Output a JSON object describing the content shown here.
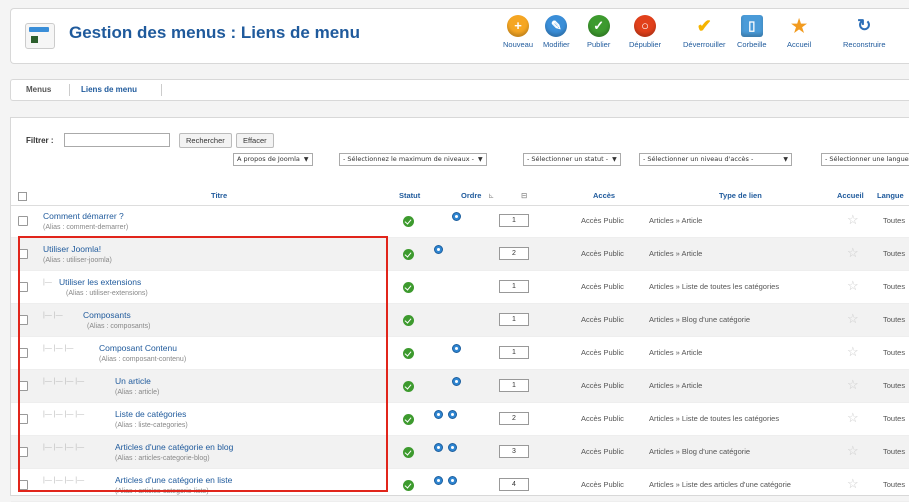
{
  "header": {
    "title": "Gestion des menus : Liens de menu"
  },
  "toolbar": [
    {
      "label": "Nouveau",
      "icon": "plus-icon",
      "color": "#f5a623"
    },
    {
      "label": "Modifier",
      "icon": "pencil-icon",
      "color": "#3a8ed8"
    },
    {
      "label": "Publier",
      "icon": "check-icon",
      "color": "#3d9a2e"
    },
    {
      "label": "Dépublier",
      "icon": "unpublish-icon",
      "color": "#e1401b"
    },
    {
      "label": "Déverrouiller",
      "icon": "checkmark-icon",
      "color": "#f5b400"
    },
    {
      "label": "Corbeille",
      "icon": "trash-icon",
      "color": "#4a9bd8"
    },
    {
      "label": "Accueil",
      "icon": "star-icon",
      "color": "#f29b1f"
    },
    {
      "label": "Reconstruire",
      "icon": "refresh-icon",
      "color": "#2d6fb8"
    }
  ],
  "tabs": [
    "Menus",
    "Liens de menu"
  ],
  "filter": {
    "label": "Filtrer :",
    "search_button": "Rechercher",
    "clear_button": "Effacer",
    "selects": [
      "A propos de Joomla",
      "- Sélectionnez le maximum de niveaux -",
      "- Sélectionner un statut -",
      "- Sélectionner un niveau d'accès -",
      "- Sélectionner une langue"
    ]
  },
  "columns": {
    "title": "Titre",
    "status": "Statut",
    "order": "Ordre",
    "access": "Accès",
    "type": "Type de lien",
    "home": "Accueil",
    "language": "Langue"
  },
  "rows": [
    {
      "title": "Comment démarrer ?",
      "alias": "(Alias : comment-demarrer)",
      "tree": "",
      "order": "1",
      "access": "Accès Public",
      "type": "Articles » Article",
      "language": "Toutes"
    },
    {
      "title": "Utiliser Joomla!",
      "alias": "(Alias : utiliser-joomla)",
      "tree": "",
      "order": "2",
      "access": "Accès Public",
      "type": "Articles » Article",
      "language": "Toutes"
    },
    {
      "title": "Utiliser les extensions",
      "alias": "(Alias : utiliser-extensions)",
      "tree": "|—",
      "order": "1",
      "access": "Accès Public",
      "type": "Articles » Liste de toutes les catégories",
      "language": "Toutes"
    },
    {
      "title": "Composants",
      "alias": "(Alias : composants)",
      "tree": "|— |—",
      "order": "1",
      "access": "Accès Public",
      "type": "Articles » Blog d'une catégorie",
      "language": "Toutes"
    },
    {
      "title": "Composant Contenu",
      "alias": "(Alias : composant-contenu)",
      "tree": "|— |— |—",
      "order": "1",
      "access": "Accès Public",
      "type": "Articles » Article",
      "language": "Toutes"
    },
    {
      "title": "Un article",
      "alias": "(Alias : article)",
      "tree": "|— |— |— |—",
      "order": "1",
      "access": "Accès Public",
      "type": "Articles » Article",
      "language": "Toutes"
    },
    {
      "title": "Liste de catégories",
      "alias": "(Alias : liste-categories)",
      "tree": "|— |— |— |—",
      "order": "2",
      "access": "Accès Public",
      "type": "Articles » Liste de toutes les catégories",
      "language": "Toutes"
    },
    {
      "title": "Articles d'une catégorie en blog",
      "alias": "(Alias : articles-categorie-blog)",
      "tree": "|— |— |— |—",
      "order": "3",
      "access": "Accès Public",
      "type": "Articles » Blog d'une catégorie",
      "language": "Toutes"
    },
    {
      "title": "Articles d'une catégorie en liste",
      "alias": "(Alias : articles-categorie-liste)",
      "tree": "|— |— |— |—",
      "order": "4",
      "access": "Accès Public",
      "type": "Articles » Liste des articles d'une catégorie",
      "language": "Toutes"
    }
  ]
}
